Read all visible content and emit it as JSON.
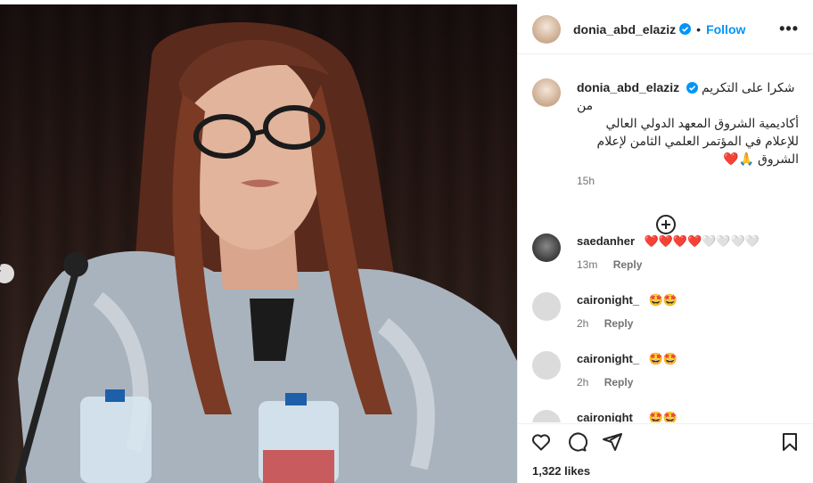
{
  "post": {
    "username": "donia_abd_elaziz",
    "follow_label": "Follow",
    "separator": "•",
    "more_label": "•••",
    "caption_username": "donia_abd_elaziz",
    "caption_lines": [
      "شكرا على التكريم من",
      "أكاديمية الشروق المعهد الدولي العالي",
      "للإعلام في المؤتمر العلمي الثامن لإعلام",
      "الشروق 🙏❤️"
    ],
    "caption_time": "15h",
    "likes": "1,322 likes"
  },
  "comments": [
    {
      "username": "saedanher",
      "text": "❤️❤️❤️❤️🤍🤍🤍🤍",
      "time": "13m",
      "reply_label": "Reply"
    },
    {
      "username": "caironight_",
      "text": "🤩🤩",
      "time": "2h",
      "reply_label": "Reply"
    },
    {
      "username": "caironight_",
      "text": "🤩🤩",
      "time": "2h",
      "reply_label": "Reply"
    },
    {
      "username": "caironight_",
      "text": "🤩🤩",
      "time": "",
      "reply_label": ""
    }
  ],
  "icons": {
    "verified": "verified-badge-icon",
    "more": "more-options-icon",
    "load_more": "plus-circle-icon",
    "like": "heart-icon",
    "comment": "comment-icon",
    "share": "share-icon",
    "save": "bookmark-icon",
    "prev": "chevron-left-icon"
  },
  "colors": {
    "accent": "#0095f6",
    "text": "#262626",
    "muted": "#737373",
    "verified": "#0095f6"
  }
}
